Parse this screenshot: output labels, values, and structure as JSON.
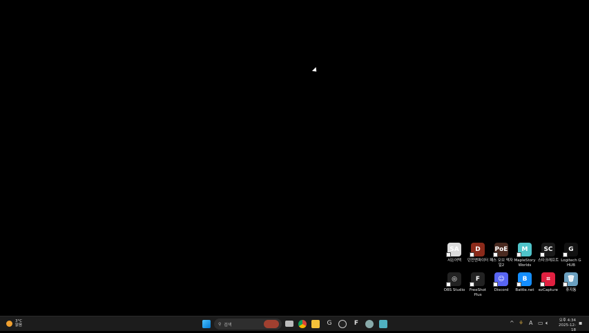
{
  "desktop": {
    "icons": [
      {
        "label": "서든어택",
        "color": "#ddd",
        "glyph": "SA"
      },
      {
        "label": "던전앤파이터",
        "color": "#8b2a1a",
        "glyph": "D"
      },
      {
        "label": "패스 오브 엑자일2",
        "color": "#4a2a20",
        "glyph": "PoE"
      },
      {
        "label": "MapleStory Worlds",
        "color": "#4fc3c9",
        "glyph": "M"
      },
      {
        "label": "스타크래프트",
        "color": "#1a1a1a",
        "glyph": "SC"
      },
      {
        "label": "Logitech G HUB",
        "color": "#111",
        "glyph": "G"
      },
      {
        "label": "OBS Studio",
        "color": "#222",
        "glyph": "◎"
      },
      {
        "label": "FreeShot Plus",
        "color": "#222",
        "glyph": "F"
      },
      {
        "label": "Discord",
        "color": "#5865f2",
        "glyph": "☺"
      },
      {
        "label": "Battle.net",
        "color": "#148eff",
        "glyph": "B"
      },
      {
        "label": "ezCapture",
        "color": "#e02040",
        "glyph": "⌗"
      },
      {
        "label": "휴지통",
        "color": "#6aa0c0",
        "glyph": "🗑"
      }
    ]
  },
  "taskbar": {
    "weather": {
      "temp": "3°C",
      "condition": "맑음"
    },
    "search": {
      "placeholder": "검색"
    },
    "clock": {
      "time": "오후 4:34",
      "date": "2025-12-18"
    },
    "tray": {
      "ime": "A"
    }
  }
}
